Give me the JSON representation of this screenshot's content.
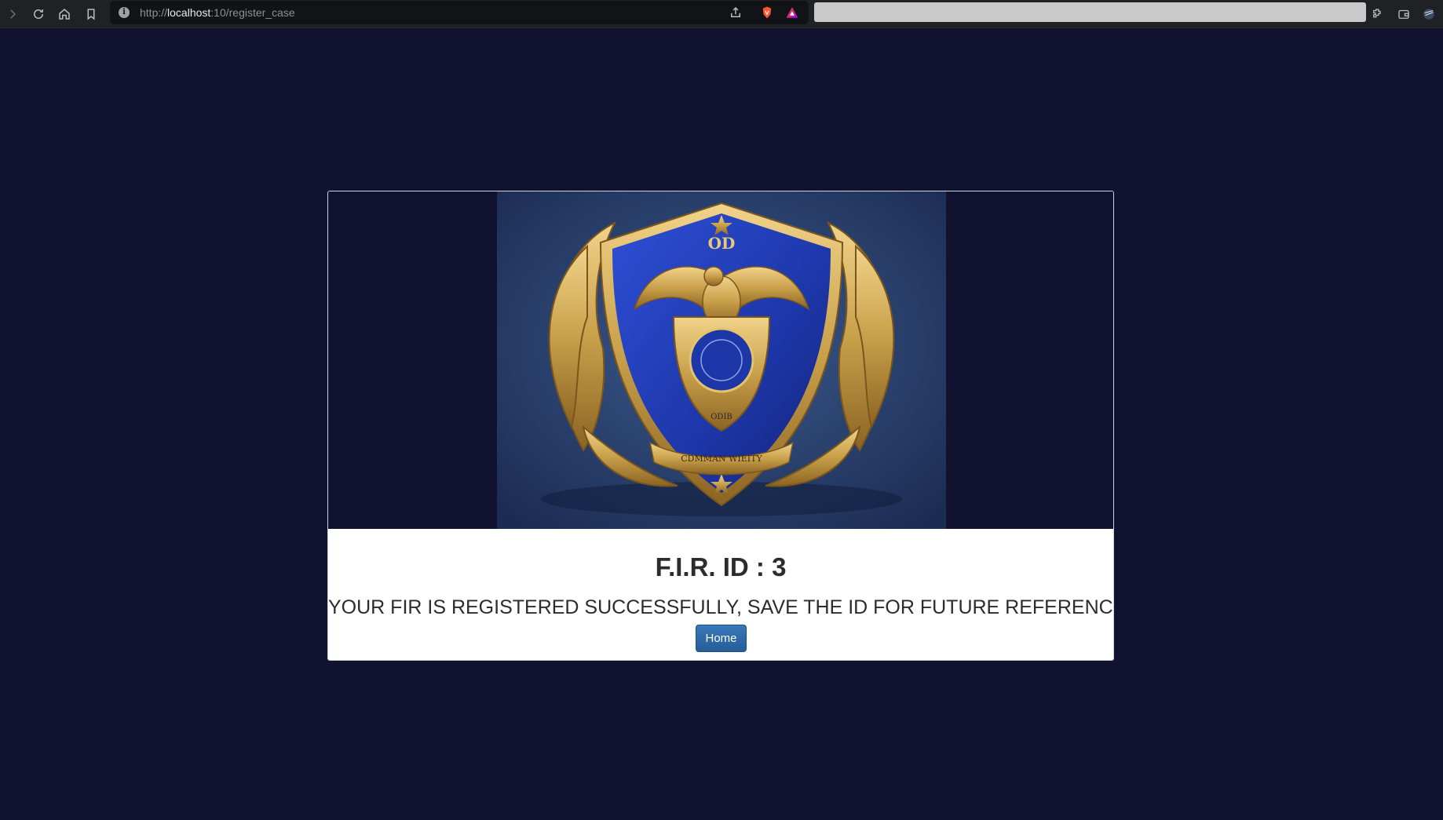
{
  "browser": {
    "url_scheme": "http://",
    "url_host": "localhost",
    "url_rest": ":10/register_case"
  },
  "result": {
    "fir_heading": "F.I.R. ID : 3",
    "message": "YOUR FIR IS REGISTERED SUCCESSFULLY, SAVE THE ID FOR FUTURE REFERENCE",
    "home_label": "Home"
  },
  "emblem": {
    "top_text": "OD",
    "lower_text": "ODIB",
    "ribbon_text": "CDMMAN WIEITY"
  },
  "colors": {
    "page_background": "#11122f",
    "button": "#2d6aa8",
    "shield_blue": "#1d36a8",
    "gold": "#c9a04a"
  }
}
